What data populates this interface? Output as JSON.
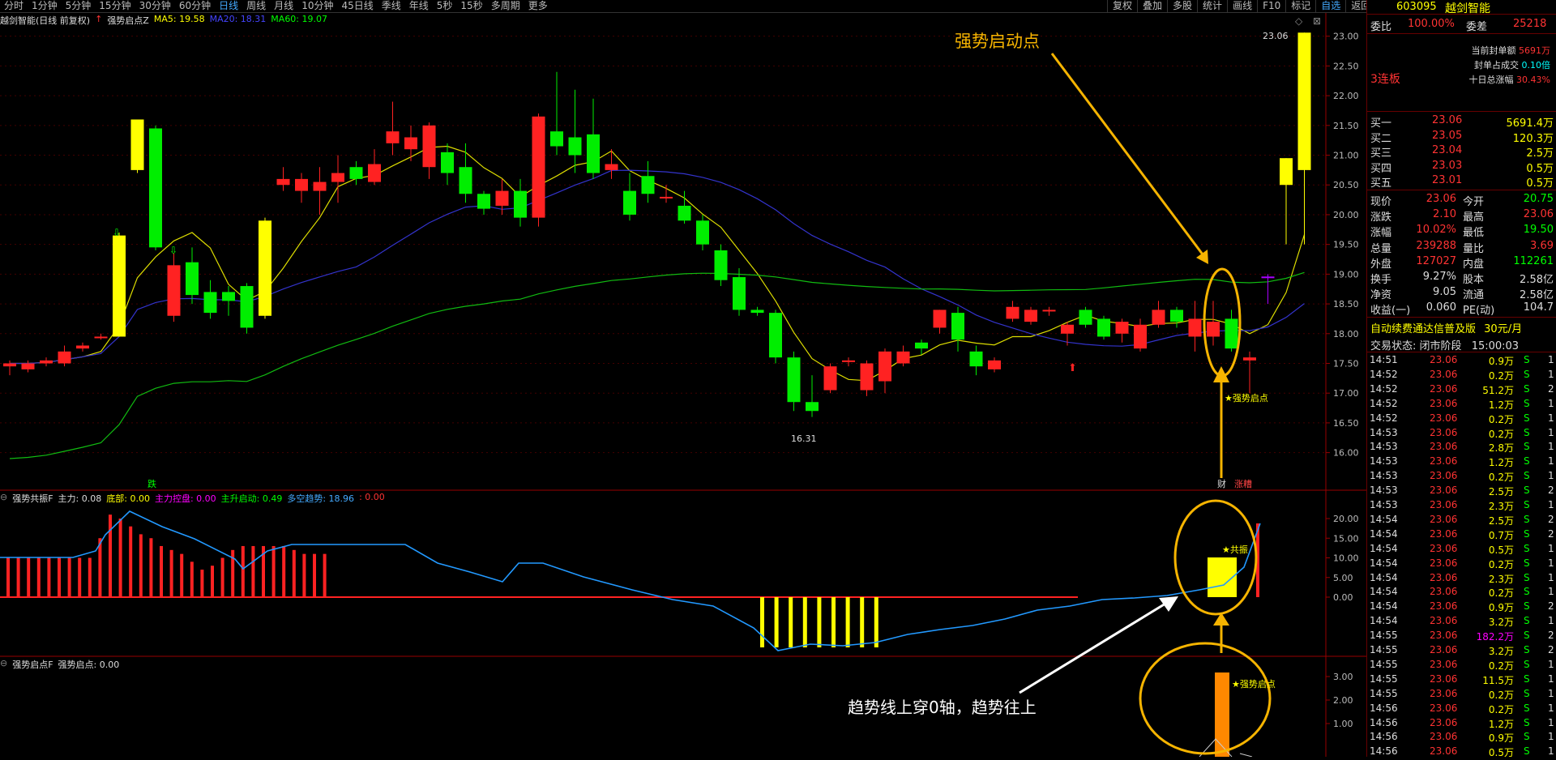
{
  "toolbar": {
    "items": [
      "分时",
      "1分钟",
      "5分钟",
      "15分钟",
      "30分钟",
      "60分钟",
      "日线",
      "周线",
      "月线",
      "10分钟",
      "45日线",
      "季线",
      "年线",
      "5秒",
      "15秒",
      "多周期",
      "更多"
    ],
    "active": "日线",
    "right_items": [
      "复权",
      "叠加",
      "多股",
      "统计",
      "画线",
      "F10",
      "标记",
      "自选",
      "返回"
    ]
  },
  "chart_header": {
    "title": "越剑智能(日线 前复权)",
    "indicator": "强势启点Z",
    "ma5": "MA5: 19.58",
    "ma20": "MA20: 18.31",
    "ma60": "MA60: 19.07"
  },
  "price_axis": [
    "23.00",
    "22.50",
    "22.00",
    "21.50",
    "21.00",
    "20.50",
    "20.00",
    "19.50",
    "19.00",
    "18.50",
    "18.00",
    "17.50",
    "17.00",
    "16.50",
    "16.00"
  ],
  "annotations": {
    "strong_start_top": "强势启动点",
    "high_label": "23.06",
    "low_label": "16.31",
    "strong_start_small": "★强势启点",
    "cai_label": "财",
    "zhangting_label": "涨糟",
    "die_label": "跌",
    "gongzhen_label": "★共振",
    "trend_text": "趋势线上穿0轴，趋势往上",
    "ind2_label": "★强势启点"
  },
  "ind1_header": {
    "name": "强势共振F",
    "zhuli": "主力: 0.08",
    "dibu": "底部: 0.00",
    "kongpan": "主力控盘: 0.00",
    "qidong": "主升启动: 0.49",
    "duokong": "多空趋势: 18.96",
    "extra": ": 0.00"
  },
  "ind1_axis": [
    "20.00",
    "15.00",
    "10.00",
    "5.00",
    "0.00"
  ],
  "ind2_header": {
    "name": "强势启点F",
    "value": "强势启点: 0.00"
  },
  "ind2_axis": [
    "3.00",
    "2.00",
    "1.00"
  ],
  "sidebar": {
    "code": "603095",
    "name": "越剑智能",
    "weibi_label": "委比",
    "weibi_value": "100.00%",
    "weicha_label": "委差",
    "weicha_value": "25218",
    "lianban": "3连板",
    "fengdan_label": "当前封单额",
    "fengdan_value": "5691万",
    "fengzhan_label": "封单占成交",
    "fengzhan_value": "0.10倍",
    "shiri_label": "十日总涨幅",
    "shiri_value": "30.43%",
    "buy": [
      {
        "label": "买一",
        "price": "23.06",
        "vol": "5691.4万"
      },
      {
        "label": "买二",
        "price": "23.05",
        "vol": "120.3万"
      },
      {
        "label": "买三",
        "price": "23.04",
        "vol": "2.5万"
      },
      {
        "label": "买四",
        "price": "23.03",
        "vol": "0.5万"
      },
      {
        "label": "买五",
        "price": "23.01",
        "vol": "0.5万"
      }
    ],
    "quote": [
      {
        "l1": "现价",
        "v1": "23.06",
        "l2": "今开",
        "v2": "20.75"
      },
      {
        "l1": "涨跌",
        "v1": "2.10",
        "l2": "最高",
        "v2": "23.06"
      },
      {
        "l1": "涨幅",
        "v1": "10.02%",
        "l2": "最低",
        "v2": "19.50"
      },
      {
        "l1": "总量",
        "v1": "239288",
        "l2": "量比",
        "v2": "3.69"
      },
      {
        "l1": "外盘",
        "v1": "127027",
        "l2": "内盘",
        "v2": "112261"
      },
      {
        "l1": "换手",
        "v1": "9.27%",
        "l2": "股本",
        "v2": "2.58亿"
      },
      {
        "l1": "净资",
        "v1": "9.05",
        "l2": "流通",
        "v2": "2.58亿"
      },
      {
        "l1": "收益(一)",
        "v1": "0.060",
        "l2": "PE(动)",
        "v2": "104.7"
      }
    ],
    "ad": "自动续费通达信普及版",
    "ad_price": "30元/月",
    "status_label": "交易状态:",
    "status_value": "闭市阶段",
    "status_time": "15:00:03",
    "ticks": [
      {
        "t": "14:51",
        "p": "23.06",
        "v": "0.9万",
        "s": "S",
        "n": "1"
      },
      {
        "t": "14:52",
        "p": "23.06",
        "v": "0.2万",
        "s": "S",
        "n": "1"
      },
      {
        "t": "14:52",
        "p": "23.06",
        "v": "51.2万",
        "s": "S",
        "n": "2"
      },
      {
        "t": "14:52",
        "p": "23.06",
        "v": "1.2万",
        "s": "S",
        "n": "1"
      },
      {
        "t": "14:52",
        "p": "23.06",
        "v": "0.2万",
        "s": "S",
        "n": "1"
      },
      {
        "t": "14:53",
        "p": "23.06",
        "v": "0.2万",
        "s": "S",
        "n": "1"
      },
      {
        "t": "14:53",
        "p": "23.06",
        "v": "2.8万",
        "s": "S",
        "n": "1"
      },
      {
        "t": "14:53",
        "p": "23.06",
        "v": "1.2万",
        "s": "S",
        "n": "1"
      },
      {
        "t": "14:53",
        "p": "23.06",
        "v": "0.2万",
        "s": "S",
        "n": "1"
      },
      {
        "t": "14:53",
        "p": "23.06",
        "v": "2.5万",
        "s": "S",
        "n": "2"
      },
      {
        "t": "14:53",
        "p": "23.06",
        "v": "2.3万",
        "s": "S",
        "n": "1"
      },
      {
        "t": "14:54",
        "p": "23.06",
        "v": "2.5万",
        "s": "S",
        "n": "2"
      },
      {
        "t": "14:54",
        "p": "23.06",
        "v": "0.7万",
        "s": "S",
        "n": "2"
      },
      {
        "t": "14:54",
        "p": "23.06",
        "v": "0.5万",
        "s": "S",
        "n": "1"
      },
      {
        "t": "14:54",
        "p": "23.06",
        "v": "0.2万",
        "s": "S",
        "n": "1"
      },
      {
        "t": "14:54",
        "p": "23.06",
        "v": "2.3万",
        "s": "S",
        "n": "1"
      },
      {
        "t": "14:54",
        "p": "23.06",
        "v": "0.2万",
        "s": "S",
        "n": "1"
      },
      {
        "t": "14:54",
        "p": "23.06",
        "v": "0.9万",
        "s": "S",
        "n": "2"
      },
      {
        "t": "14:54",
        "p": "23.06",
        "v": "3.2万",
        "s": "S",
        "n": "1"
      },
      {
        "t": "14:55",
        "p": "23.06",
        "v": "182.2万",
        "s": "S",
        "n": "2"
      },
      {
        "t": "14:55",
        "p": "23.06",
        "v": "3.2万",
        "s": "S",
        "n": "2"
      },
      {
        "t": "14:55",
        "p": "23.06",
        "v": "0.2万",
        "s": "S",
        "n": "1"
      },
      {
        "t": "14:55",
        "p": "23.06",
        "v": "11.5万",
        "s": "S",
        "n": "1"
      },
      {
        "t": "14:55",
        "p": "23.06",
        "v": "0.2万",
        "s": "S",
        "n": "1"
      },
      {
        "t": "14:56",
        "p": "23.06",
        "v": "0.2万",
        "s": "S",
        "n": "1"
      },
      {
        "t": "14:56",
        "p": "23.06",
        "v": "1.2万",
        "s": "S",
        "n": "1"
      },
      {
        "t": "14:56",
        "p": "23.06",
        "v": "0.9万",
        "s": "S",
        "n": "1"
      },
      {
        "t": "14:56",
        "p": "23.06",
        "v": "0.5万",
        "s": "S",
        "n": "1"
      }
    ]
  },
  "chart_data": {
    "type": "candlestick",
    "price_range": [
      15.6,
      23.2
    ],
    "candles": [
      [
        17.45,
        17.5,
        17.3,
        17.55
      ],
      [
        17.4,
        17.5,
        17.35,
        17.55
      ],
      [
        17.5,
        17.55,
        17.45,
        17.6
      ],
      [
        17.5,
        17.7,
        17.45,
        17.8
      ],
      [
        17.75,
        17.8,
        17.7,
        17.85
      ],
      [
        17.95,
        17.95,
        17.9,
        18.0
      ],
      [
        17.95,
        19.65,
        17.95,
        19.7
      ],
      [
        20.75,
        21.6,
        20.7,
        21.6
      ],
      [
        21.45,
        19.45,
        19.4,
        21.5
      ],
      [
        18.3,
        19.15,
        18.2,
        19.35
      ],
      [
        19.2,
        18.65,
        18.5,
        19.45
      ],
      [
        18.7,
        18.35,
        18.25,
        18.9
      ],
      [
        18.7,
        18.55,
        18.3,
        18.8
      ],
      [
        18.8,
        18.1,
        18.0,
        18.85
      ],
      [
        18.3,
        19.9,
        18.25,
        19.95
      ],
      [
        20.5,
        20.6,
        20.4,
        20.8
      ],
      [
        20.4,
        20.6,
        20.2,
        20.7
      ],
      [
        20.4,
        20.55,
        20.0,
        20.8
      ],
      [
        20.55,
        20.7,
        20.2,
        21.0
      ],
      [
        20.8,
        20.6,
        20.5,
        20.9
      ],
      [
        20.55,
        20.85,
        20.5,
        21.1
      ],
      [
        21.2,
        21.4,
        21.0,
        21.9
      ],
      [
        21.1,
        21.3,
        20.9,
        21.5
      ],
      [
        20.8,
        21.5,
        20.6,
        21.55
      ],
      [
        21.05,
        20.7,
        20.5,
        21.2
      ],
      [
        20.8,
        20.35,
        20.2,
        21.2
      ],
      [
        20.35,
        20.1,
        20.0,
        20.4
      ],
      [
        20.15,
        20.4,
        20.0,
        20.6
      ],
      [
        20.4,
        19.95,
        19.8,
        20.6
      ],
      [
        19.95,
        21.65,
        19.8,
        21.7
      ],
      [
        21.4,
        21.15,
        21.0,
        22.4
      ],
      [
        21.3,
        21.0,
        20.7,
        22.1
      ],
      [
        21.35,
        20.7,
        20.6,
        21.95
      ],
      [
        20.75,
        20.85,
        20.6,
        21.1
      ],
      [
        20.4,
        20.0,
        19.9,
        20.7
      ],
      [
        20.65,
        20.35,
        20.2,
        20.9
      ],
      [
        20.3,
        20.3,
        20.2,
        20.5
      ],
      [
        20.15,
        19.9,
        19.85,
        20.4
      ],
      [
        19.9,
        19.5,
        19.4,
        20.0
      ],
      [
        19.4,
        18.9,
        18.8,
        19.5
      ],
      [
        18.95,
        18.4,
        18.3,
        19.1
      ],
      [
        18.4,
        18.35,
        18.3,
        18.45
      ],
      [
        18.35,
        17.6,
        17.5,
        18.4
      ],
      [
        17.6,
        16.85,
        16.7,
        17.7
      ],
      [
        16.85,
        16.7,
        16.6,
        17.3
      ],
      [
        17.05,
        17.45,
        17.0,
        17.5
      ],
      [
        17.55,
        17.55,
        17.45,
        17.6
      ],
      [
        17.05,
        17.5,
        16.95,
        17.55
      ],
      [
        17.2,
        17.7,
        17.0,
        17.75
      ],
      [
        17.5,
        17.7,
        17.45,
        17.8
      ],
      [
        17.85,
        17.75,
        17.65,
        17.9
      ],
      [
        18.1,
        18.4,
        18.0,
        18.4
      ],
      [
        18.35,
        17.9,
        17.7,
        18.45
      ],
      [
        17.7,
        17.45,
        17.3,
        17.8
      ],
      [
        17.4,
        17.55,
        17.35,
        17.6
      ],
      [
        18.25,
        18.45,
        18.2,
        18.55
      ],
      [
        18.2,
        18.4,
        18.15,
        18.45
      ],
      [
        18.4,
        18.4,
        18.3,
        18.45
      ],
      [
        18.0,
        18.15,
        17.8,
        18.2
      ],
      [
        18.4,
        18.15,
        18.1,
        18.45
      ],
      [
        18.25,
        17.95,
        17.9,
        18.3
      ],
      [
        18.0,
        18.2,
        17.85,
        18.25
      ],
      [
        17.75,
        18.15,
        17.7,
        18.25
      ],
      [
        18.15,
        18.4,
        18.1,
        18.55
      ],
      [
        18.4,
        18.2,
        18.1,
        18.45
      ],
      [
        17.95,
        18.25,
        17.7,
        18.55
      ],
      [
        17.95,
        18.2,
        17.8,
        18.55
      ],
      [
        18.25,
        17.75,
        17.7,
        18.4
      ],
      [
        17.55,
        17.6,
        17.0,
        17.7
      ],
      [
        18.96,
        18.96,
        18.5,
        19.0
      ],
      [
        20.5,
        20.95,
        19.5,
        20.95
      ],
      [
        20.75,
        23.06,
        19.5,
        23.06
      ]
    ]
  }
}
